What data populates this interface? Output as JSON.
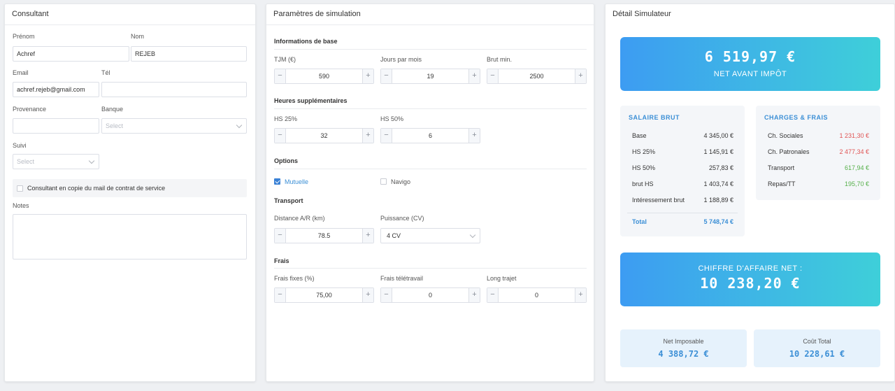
{
  "consultant": {
    "title": "Consultant",
    "prenom_label": "Prénom",
    "prenom_value": "Achref",
    "nom_label": "Nom",
    "nom_value": "REJEB",
    "email_label": "Email",
    "email_value": "achref.rejeb@gmail.com",
    "tel_label": "Tél",
    "tel_value": "",
    "provenance_label": "Provenance",
    "provenance_value": "",
    "banque_label": "Banque",
    "banque_placeholder": "Select",
    "suivi_label": "Suivi",
    "suivi_placeholder": "Select",
    "copy_label": "Consultant en copie du mail de contrat de service",
    "copy_checked": false,
    "notes_label": "Notes",
    "notes_value": ""
  },
  "simulation": {
    "title": "Paramètres de simulation",
    "base_title": "Informations de base",
    "tjm_label": "TJM (€)",
    "tjm_value": "590",
    "jours_label": "Jours par mois",
    "jours_value": "19",
    "brut_min_label": "Brut min.",
    "brut_min_value": "2500",
    "hs_title": "Heures supplémentaires",
    "hs25_label": "HS 25%",
    "hs25_value": "32",
    "hs50_label": "HS 50%",
    "hs50_value": "6",
    "options_title": "Options",
    "mutuelle_label": "Mutuelle",
    "mutuelle_checked": true,
    "navigo_label": "Navigo",
    "navigo_checked": false,
    "transport_title": "Transport",
    "distance_label": "Distance A/R (km)",
    "distance_value": "78.5",
    "puissance_label": "Puissance (CV)",
    "puissance_value": "4 CV",
    "frais_title": "Frais",
    "frais_fixes_label": "Frais fixes (%)",
    "frais_fixes_value": "75,00",
    "frais_teletravail_label": "Frais télétravail",
    "frais_teletravail_value": "0",
    "long_trajet_label": "Long trajet",
    "long_trajet_value": "0",
    "minus": "−",
    "plus": "+"
  },
  "detail": {
    "title": "Détail Simulateur",
    "net_value": "6 519,97 €",
    "net_label": "NET AVANT IMPÔT",
    "salaire_title": "SALAIRE BRUT",
    "salaire_rows": [
      {
        "label": "Base",
        "value": "4 345,00 €"
      },
      {
        "label": "HS 25%",
        "value": "1 145,91 €"
      },
      {
        "label": "HS 50%",
        "value": "257,83 €"
      },
      {
        "label": "brut HS",
        "value": "1 403,74 €"
      },
      {
        "label": "Intéressement brut",
        "value": "1 188,89 €"
      }
    ],
    "total_label": "Total",
    "total_value": "5 748,74 €",
    "charges_title": "CHARGES & FRAIS",
    "charges_rows": [
      {
        "label": "Ch. Sociales",
        "value": "1 231,30 €",
        "color": "#e05555"
      },
      {
        "label": "Ch. Patronales",
        "value": "2 477,34 €",
        "color": "#e05555"
      },
      {
        "label": "Transport",
        "value": "617,94 €",
        "color": "#56b04a"
      },
      {
        "label": "Repas/TT",
        "value": "195,70 €",
        "color": "#56b04a"
      }
    ],
    "ca_label": "CHIFFRE D'AFFAIRE NET :",
    "ca_value": "10 238,20 €",
    "net_imposable_label": "Net Imposable",
    "net_imposable_value": "4 388,72 €",
    "cout_total_label": "Coût Total",
    "cout_total_value": "10 228,61 €"
  },
  "colors": {
    "accent": "#3b8fd6",
    "gradient_start": "#3d9cf2",
    "gradient_end": "#3ecfd9",
    "negative": "#e05555",
    "positive": "#56b04a"
  }
}
